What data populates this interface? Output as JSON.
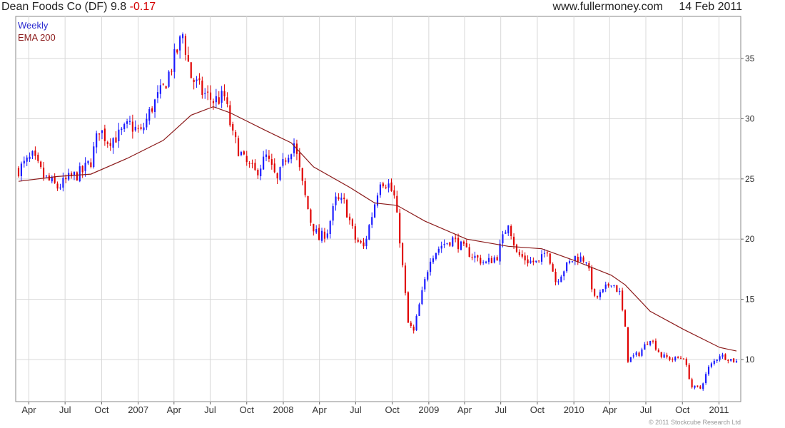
{
  "header": {
    "title": "Dean Foods Co (DF) 9.8",
    "change": "-0.17",
    "website": "www.fullermoney.com",
    "date": "14 Feb 2011"
  },
  "footer": {
    "copyright": "© 2011 Stockcube Research Ltd"
  },
  "colors": {
    "up": "#1a1aff",
    "down": "#e00000",
    "ema": "#8b1a1a",
    "grid": "#d8d8d8",
    "legend_weekly": "#2a2ad0",
    "legend_ema": "#8b1a1a"
  },
  "chart_data": {
    "type": "candlestick",
    "legend": [
      "Weekly",
      "EMA 200"
    ],
    "y_ticks": [
      10,
      15,
      20,
      25,
      30,
      35
    ],
    "ylim": [
      6.5,
      38.5
    ],
    "x_ticks": [
      "Apr",
      "Jul",
      "Oct",
      "2007",
      "Apr",
      "Jul",
      "Oct",
      "2008",
      "Apr",
      "Jul",
      "Oct",
      "2009",
      "Apr",
      "Jul",
      "Oct",
      "2010",
      "Apr",
      "Jul",
      "Oct",
      "2011"
    ],
    "x_start": "2006-03-06",
    "x_tick_dates": [
      "2006-04-01",
      "2006-07-01",
      "2006-10-01",
      "2007-01-01",
      "2007-04-01",
      "2007-07-01",
      "2007-10-01",
      "2008-01-01",
      "2008-04-01",
      "2008-07-01",
      "2008-10-01",
      "2009-01-01",
      "2009-04-01",
      "2009-07-01",
      "2009-10-01",
      "2010-01-01",
      "2010-04-01",
      "2010-07-01",
      "2010-10-01",
      "2011-01-01"
    ],
    "price_path": [
      [
        "2006-03-06",
        25.8
      ],
      [
        "2006-04-10",
        26.8
      ],
      [
        "2006-05-08",
        25.2
      ],
      [
        "2006-06-12",
        24.3
      ],
      [
        "2006-07-10",
        25.0
      ],
      [
        "2006-08-14",
        25.6
      ],
      [
        "2006-09-04",
        26.5
      ],
      [
        "2006-09-25",
        29.2
      ],
      [
        "2006-10-16",
        28.2
      ],
      [
        "2006-11-13",
        28.6
      ],
      [
        "2006-12-11",
        29.5
      ],
      [
        "2007-01-08",
        28.8
      ],
      [
        "2007-02-05",
        31.0
      ],
      [
        "2007-03-05",
        32.5
      ],
      [
        "2007-04-02",
        35.0
      ],
      [
        "2007-04-23",
        37.0
      ],
      [
        "2007-05-14",
        33.5
      ],
      [
        "2007-06-11",
        32.2
      ],
      [
        "2007-07-09",
        31.5
      ],
      [
        "2007-08-06",
        31.8
      ],
      [
        "2007-08-27",
        28.5
      ],
      [
        "2007-09-24",
        26.5
      ],
      [
        "2007-10-22",
        25.5
      ],
      [
        "2007-11-19",
        26.8
      ],
      [
        "2007-12-17",
        24.8
      ],
      [
        "2008-01-07",
        26.8
      ],
      [
        "2008-01-28",
        28.0
      ],
      [
        "2008-02-18",
        24.5
      ],
      [
        "2008-03-10",
        21.5
      ],
      [
        "2008-03-31",
        20.0
      ],
      [
        "2008-04-21",
        20.7
      ],
      [
        "2008-05-12",
        23.2
      ],
      [
        "2008-06-02",
        23.0
      ],
      [
        "2008-06-30",
        20.0
      ],
      [
        "2008-07-21",
        19.3
      ],
      [
        "2008-08-11",
        22.0
      ],
      [
        "2008-09-01",
        25.0
      ],
      [
        "2008-09-22",
        24.5
      ],
      [
        "2008-10-06",
        23.5
      ],
      [
        "2008-10-20",
        20.0
      ],
      [
        "2008-11-10",
        13.0
      ],
      [
        "2008-11-24",
        12.3
      ],
      [
        "2008-12-08",
        14.5
      ],
      [
        "2009-01-05",
        18.5
      ],
      [
        "2009-02-02",
        19.5
      ],
      [
        "2009-03-02",
        20.0
      ],
      [
        "2009-03-30",
        19.2
      ],
      [
        "2009-04-27",
        18.5
      ],
      [
        "2009-05-25",
        18.0
      ],
      [
        "2009-06-22",
        18.6
      ],
      [
        "2009-07-20",
        21.5
      ],
      [
        "2009-08-10",
        18.8
      ],
      [
        "2009-09-07",
        18.2
      ],
      [
        "2009-10-05",
        18.0
      ],
      [
        "2009-10-26",
        19.2
      ],
      [
        "2009-11-16",
        16.5
      ],
      [
        "2009-12-07",
        17.5
      ],
      [
        "2010-01-04",
        18.5
      ],
      [
        "2010-02-01",
        18.3
      ],
      [
        "2010-02-22",
        15.0
      ],
      [
        "2010-03-15",
        15.6
      ],
      [
        "2010-04-05",
        16.5
      ],
      [
        "2010-04-26",
        15.5
      ],
      [
        "2010-05-10",
        12.5
      ],
      [
        "2010-05-17",
        10.0
      ],
      [
        "2010-06-14",
        10.5
      ],
      [
        "2010-07-12",
        11.8
      ],
      [
        "2010-08-09",
        10.3
      ],
      [
        "2010-09-06",
        10.0
      ],
      [
        "2010-10-04",
        10.2
      ],
      [
        "2010-10-25",
        7.7
      ],
      [
        "2010-11-15",
        7.6
      ],
      [
        "2010-12-06",
        9.3
      ],
      [
        "2011-01-03",
        10.4
      ],
      [
        "2011-02-14",
        9.8
      ]
    ],
    "ema_path": [
      [
        "2006-03-06",
        24.8
      ],
      [
        "2006-06-12",
        25.2
      ],
      [
        "2006-09-04",
        25.4
      ],
      [
        "2006-12-04",
        26.7
      ],
      [
        "2007-03-05",
        28.2
      ],
      [
        "2007-05-14",
        30.3
      ],
      [
        "2007-07-09",
        31.0
      ],
      [
        "2007-08-20",
        30.5
      ],
      [
        "2007-11-19",
        29.0
      ],
      [
        "2008-01-21",
        28.0
      ],
      [
        "2008-03-17",
        26.0
      ],
      [
        "2008-06-16",
        24.3
      ],
      [
        "2008-08-18",
        23.0
      ],
      [
        "2008-10-13",
        22.8
      ],
      [
        "2008-12-22",
        21.5
      ],
      [
        "2009-04-06",
        20.0
      ],
      [
        "2009-07-20",
        19.4
      ],
      [
        "2009-10-12",
        19.2
      ],
      [
        "2010-01-04",
        18.2
      ],
      [
        "2010-04-05",
        17.0
      ],
      [
        "2010-05-10",
        16.2
      ],
      [
        "2010-07-12",
        14.0
      ],
      [
        "2010-10-04",
        12.5
      ],
      [
        "2011-01-03",
        11.0
      ],
      [
        "2011-02-14",
        10.7
      ]
    ]
  }
}
